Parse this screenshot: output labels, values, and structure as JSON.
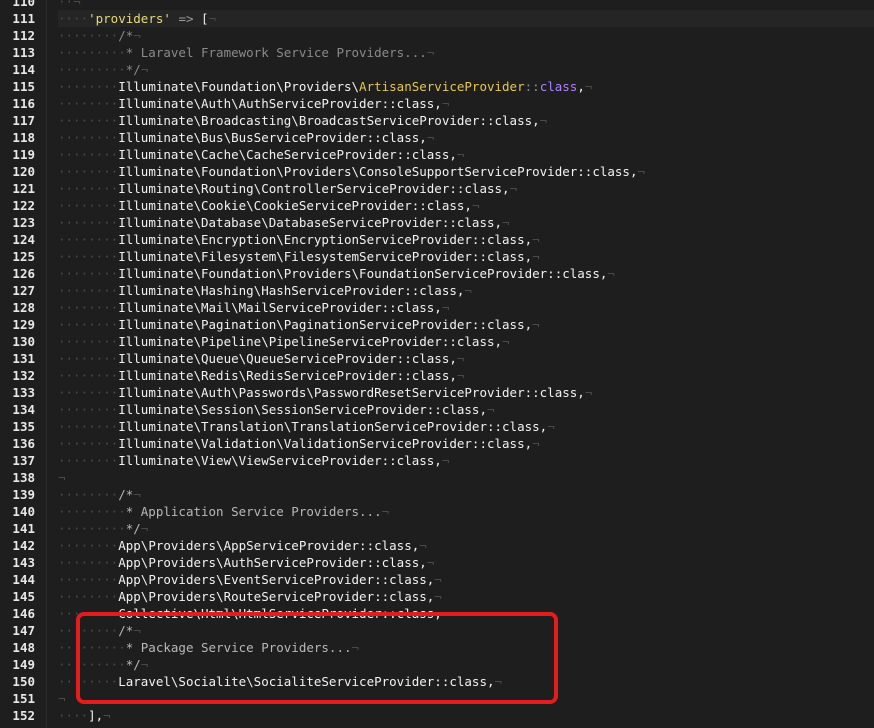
{
  "editor": {
    "line_numbers": [
      "110",
      "111",
      "112",
      "113",
      "114",
      "115",
      "116",
      "117",
      "118",
      "119",
      "120",
      "121",
      "122",
      "123",
      "124",
      "125",
      "126",
      "127",
      "128",
      "129",
      "130",
      "131",
      "132",
      "133",
      "134",
      "135",
      "136",
      "137",
      "138",
      "139",
      "140",
      "141",
      "142",
      "143",
      "144",
      "145",
      "146",
      "147",
      "148",
      "149",
      "150",
      "151",
      "152"
    ],
    "lines": {
      "l111": {
        "key": "'providers'",
        "arrow": "=>",
        "bracket": "["
      },
      "l112": "/*",
      "l113": "* Laravel Framework Service Providers...",
      "l114": "*/",
      "l115": {
        "prefix": "Illuminate\\Foundation\\Providers\\",
        "cls": "ArtisanServiceProvider",
        "colons": "::",
        "kw": "class",
        "tail": ","
      },
      "l116": "Illuminate\\Auth\\AuthServiceProvider::class,",
      "l117": "Illuminate\\Broadcasting\\BroadcastServiceProvider::class,",
      "l118": "Illuminate\\Bus\\BusServiceProvider::class,",
      "l119": "Illuminate\\Cache\\CacheServiceProvider::class,",
      "l120": "Illuminate\\Foundation\\Providers\\ConsoleSupportServiceProvider::class,",
      "l121": "Illuminate\\Routing\\ControllerServiceProvider::class,",
      "l122": "Illuminate\\Cookie\\CookieServiceProvider::class,",
      "l123": "Illuminate\\Database\\DatabaseServiceProvider::class,",
      "l124": "Illuminate\\Encryption\\EncryptionServiceProvider::class,",
      "l125": "Illuminate\\Filesystem\\FilesystemServiceProvider::class,",
      "l126": "Illuminate\\Foundation\\Providers\\FoundationServiceProvider::class,",
      "l127": "Illuminate\\Hashing\\HashServiceProvider::class,",
      "l128": "Illuminate\\Mail\\MailServiceProvider::class,",
      "l129": "Illuminate\\Pagination\\PaginationServiceProvider::class,",
      "l130": "Illuminate\\Pipeline\\PipelineServiceProvider::class,",
      "l131": "Illuminate\\Queue\\QueueServiceProvider::class,",
      "l132": "Illuminate\\Redis\\RedisServiceProvider::class,",
      "l133": "Illuminate\\Auth\\Passwords\\PasswordResetServiceProvider::class,",
      "l134": "Illuminate\\Session\\SessionServiceProvider::class,",
      "l135": "Illuminate\\Translation\\TranslationServiceProvider::class,",
      "l136": "Illuminate\\Validation\\ValidationServiceProvider::class,",
      "l137": "Illuminate\\View\\ViewServiceProvider::class,",
      "l139": "/*",
      "l140": "* Application Service Providers...",
      "l141": "*/",
      "l142": "App\\Providers\\AppServiceProvider::class,",
      "l143": "App\\Providers\\AuthServiceProvider::class,",
      "l144": "App\\Providers\\EventServiceProvider::class,",
      "l145": "App\\Providers\\RouteServiceProvider::class,",
      "l146": "Collective\\Html\\HtmlServiceProvider::class,",
      "l147": "/*",
      "l148": "* Package Service Providers...",
      "l149": "*/",
      "l150": "Laravel\\Socialite\\SocialiteServiceProvider::class,",
      "l152": "],"
    }
  },
  "colors": {
    "background": "#1e1e1e",
    "highlight_box": "#e51c1c",
    "string": "#e6db74",
    "class_highlight": "#e6c84b",
    "keyword": "#ae81ff"
  }
}
